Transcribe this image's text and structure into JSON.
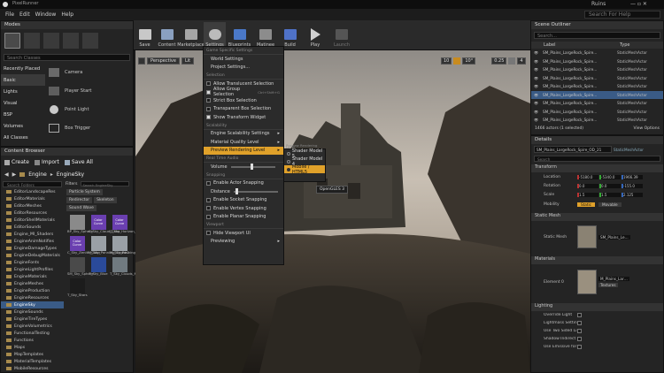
{
  "window": {
    "title": "PixelRunner",
    "project": "Ruins",
    "help_search_placeholder": "Search For Help"
  },
  "menubar": [
    "File",
    "Edit",
    "Window",
    "Help"
  ],
  "modes": {
    "tab": "Modes",
    "search_placeholder": "Search Classes",
    "categories": [
      "Recently Placed",
      "Basic",
      "Lights",
      "Visual",
      "BSP",
      "Volumes",
      "All Classes"
    ],
    "items": [
      "Camera",
      "Player Start",
      "Point Light",
      "Box Trigger"
    ]
  },
  "toolbar": {
    "buttons": [
      "Save",
      "Content",
      "Marketplace",
      "Settings",
      "Blueprints",
      "Matinee",
      "Build",
      "Play",
      "Launch"
    ]
  },
  "viewport": {
    "perspective": "Perspective",
    "lit": "Lit",
    "grid": "10",
    "rot": "10°",
    "scale": "0.25",
    "cam": "4"
  },
  "settings_menu": {
    "sections": {
      "game": "Game Specific Settings",
      "selection": "Selection",
      "scalability": "Scalability",
      "realtime": "Real Time Audio",
      "snapping": "Snapping",
      "viewport": "Viewport"
    },
    "world_settings": "World Settings",
    "project_settings": "Project Settings...",
    "allow_translucent": "Allow Translucent Selection",
    "allow_group": "Allow Group Selection",
    "allow_group_shortcut": "Ctrl+Shift+G",
    "strict_box": "Strict Box Selection",
    "transparent_box": "Transparent Box Selection",
    "show_transform": "Show Transform Widget",
    "engine_scalability": "Engine Scalability Settings",
    "material_quality": "Material Quality Level",
    "preview_rendering": "Preview Rendering Level",
    "volume": "Volume",
    "actor_snapping": "Enable Actor Snapping",
    "distance": "Distance",
    "socket_snapping": "Enable Socket Snapping",
    "vertex_snapping": "Enable Vertex Snapping",
    "planar_snapping": "Enable Planar Snapping",
    "hide_viewport_ui": "Hide Viewport UI",
    "previewing": "Previewing"
  },
  "preview_submenu": {
    "header": "Preview Rendering Level",
    "options": [
      "Shader Model 5",
      "Shader Model 4",
      "Mobile / HTML5"
    ],
    "tooltip": "OpenGLES 3"
  },
  "content_browser": {
    "tab": "Content Browser",
    "create": "Create",
    "import": "Import",
    "save_all": "Save All",
    "path": [
      "Engine",
      "EngineSky"
    ],
    "search_folders": "Search Folders",
    "filters": "Filters",
    "search_assets": "Search EngineSky",
    "filter_chips": [
      "Particle System",
      "Redirector",
      "Skeleton",
      "Sound Wave"
    ],
    "folders": [
      "EditorLandscapeRes",
      "EditorMaterials",
      "EditorMeshes",
      "EditorResources",
      "EditorShellMaterials",
      "EditorSounds",
      "Engine_MI_Shaders",
      "EngineAnimNotifies",
      "EngineDamageTypes",
      "EngineDebugMaterials",
      "EngineFonts",
      "EngineLightProfiles",
      "EngineMaterials",
      "EngineMeshes",
      "EngineProduction",
      "EngineResources",
      "EngineSky",
      "EngineSounds",
      "EngineTireTypes",
      "EngineVolumetrics",
      "FunctionalTesting",
      "Functions",
      "Maps",
      "MapTemplates",
      "MaterialTemplates",
      "MobileResources"
    ],
    "assets": [
      "BP_Sky_Sphere",
      "C_Sky_Cloud_Color",
      "C_Sky_Horizon_Color",
      "C_Sky_Zenith_Color",
      "M_Sky_Panning_Clouds2",
      "M_Sky_Panning_Clouds2",
      "SM_Sky_Sphere",
      "T_Sky_Blue",
      "T_Sky_Clouds_M",
      "T_Sky_Stars"
    ],
    "color_curve": "Color Curve"
  },
  "outliner": {
    "tab": "Scene Outliner",
    "search_placeholder": "Search...",
    "col_label": "Label",
    "col_type": "Type",
    "rows": [
      {
        "label": "SM_Plains_LargeRock_Spire…",
        "type": "StaticMeshActor"
      },
      {
        "label": "SM_Plains_LargeRock_Spire…",
        "type": "StaticMeshActor"
      },
      {
        "label": "SM_Plains_LargeRock_Spire…",
        "type": "StaticMeshActor"
      },
      {
        "label": "SM_Plains_LargeRock_Spire…",
        "type": "StaticMeshActor"
      },
      {
        "label": "SM_Plains_LargeRock_Spire…",
        "type": "StaticMeshActor"
      },
      {
        "label": "SM_Plains_LargeRock_Spire…",
        "type": "StaticMeshActor"
      },
      {
        "label": "SM_Plains_LargeRock_Spire…",
        "type": "StaticMeshActor"
      },
      {
        "label": "SM_Plains_LargeRock_Spire…",
        "type": "StaticMeshActor"
      },
      {
        "label": "SM_Plains_LargeRock_Spire…",
        "type": "StaticMeshActor"
      }
    ],
    "footer": "1466 actors (1 selected)",
    "view_options": "View Options"
  },
  "details": {
    "tab": "Details",
    "name": "SM_Plains_LargeRock_Spire_OD_21",
    "class": "StaticMeshActor",
    "search_placeholder": "Search",
    "transform": "Transform",
    "location": "Location",
    "rotation": "Rotation",
    "scale": "Scale",
    "loc": [
      "-5180.0",
      "-5340.0",
      "1966.39"
    ],
    "rot": [
      "0.0",
      "0.0",
      "-155.0"
    ],
    "scl": [
      "1.5",
      "1.5",
      "2.125"
    ],
    "mobility": "Mobility",
    "mobility_options": [
      "Static",
      "Movable"
    ],
    "static_mesh_section": "Static Mesh",
    "static_mesh_label": "Static Mesh",
    "static_mesh_value": "SM_Plains_Le…",
    "materials_section": "Materials",
    "element0": "Element 0",
    "material_value": "M_Plains_Lar…",
    "textures": "Textures",
    "lighting_section": "Lighting",
    "lighting_rows": [
      "Override Light",
      "Lightmass Settings",
      "Use Two Sided Li",
      "Shadow Indirect",
      "Use Emissive for"
    ]
  },
  "colors": {
    "accent": "#e0a12a",
    "selection": "#3a5b86"
  }
}
